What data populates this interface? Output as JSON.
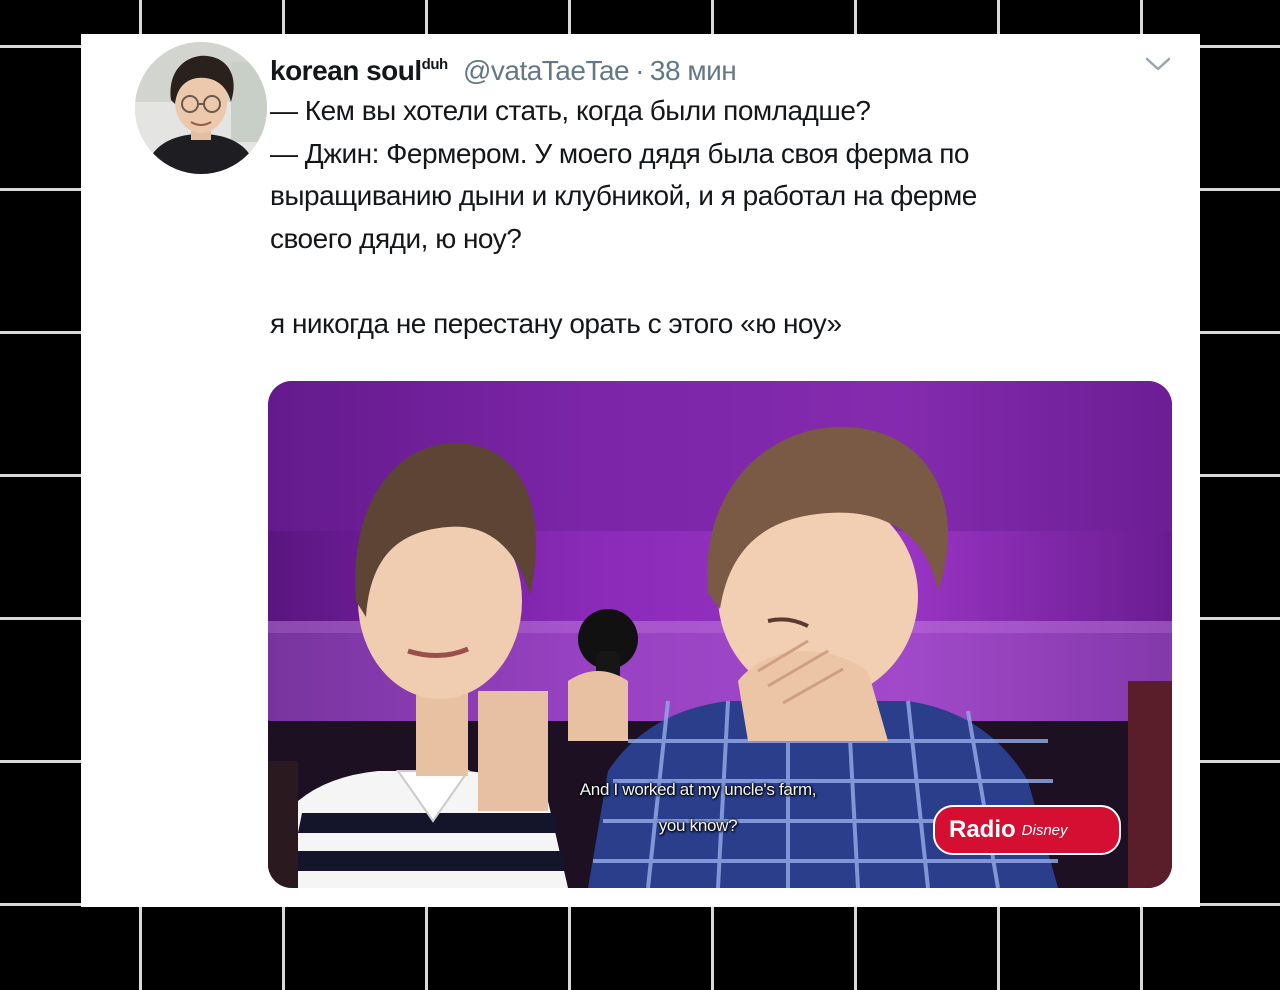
{
  "tweet": {
    "author": {
      "display_name": "korean soul",
      "display_name_suffix": "duh",
      "handle": "@vataTaeTae",
      "separator": "·",
      "timestamp": "38 мин"
    },
    "text": "— Кем вы хотели стать, когда были помладше?\n— Джин: Фермером. У моего дядя была своя ферма по\nвыращиванию дыни и клубникой, и я работал на ферме\nсвоего дяди, ю ноу?\n\nя никогда не перестану орать с этого «ю ноу»",
    "media": {
      "subtitle_line_1": "And I worked at my uncle's farm,",
      "subtitle_line_2": "you know?",
      "watermark_main": "Radio",
      "watermark_brand": "Disney"
    }
  },
  "colors": {
    "background": "#000000",
    "grid_lines": "#d9d9d9",
    "card": "#ffffff",
    "text_primary": "#14171a",
    "text_secondary": "#657786",
    "media_purple": "#7a25a8",
    "watermark_red": "#d40f31"
  },
  "icons": {
    "caret": "chevron-down-icon"
  }
}
